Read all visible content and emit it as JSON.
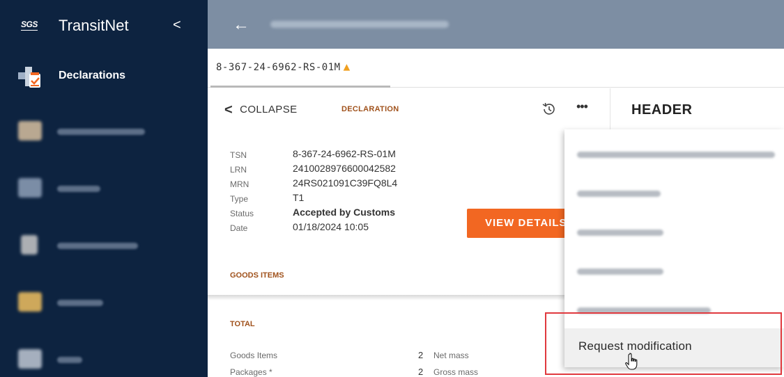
{
  "app": {
    "logo": "SGS",
    "name": "TransitNet",
    "collapse_glyph": "<"
  },
  "sidebar": {
    "active_item": {
      "label": "Declarations",
      "icon": "declarations-icon"
    },
    "blurred_items": [
      {
        "icon": "service-icon",
        "color": "#d8c0a0"
      },
      {
        "icon": "parties-icon",
        "color": "#8fa0b8"
      },
      {
        "icon": "reference-icon",
        "color": "#c8c8c8"
      },
      {
        "icon": "reports-icon",
        "color": "#f0c060"
      },
      {
        "icon": "user-icon",
        "color": "#c0c8d4"
      }
    ]
  },
  "topbar": {
    "back_icon": "arrow-left-icon"
  },
  "tab": {
    "label": "8-367-24-6962-RS-01M",
    "warning_icon": "warning-triangle-icon",
    "warning_color": "#f0a020"
  },
  "card": {
    "collapse_label": "COLLAPSE",
    "section_tab": "DECLARATION",
    "fields": [
      {
        "label": "TSN",
        "value": "8-367-24-6962-RS-01M"
      },
      {
        "label": "LRN",
        "value": "2410028976600042582"
      },
      {
        "label": "MRN",
        "value": "24RS021091C39FQ8L4"
      },
      {
        "label": "Type",
        "value": "T1"
      },
      {
        "label": "Status",
        "value": "Accepted by Customs"
      },
      {
        "label": "Date",
        "value": "01/18/2024 10:05"
      }
    ],
    "view_details": "VIEW DETAILS",
    "goods_items": "GOODS ITEMS",
    "accent_color": "#f26722"
  },
  "total": {
    "title": "TOTAL",
    "rows": [
      {
        "label": "Goods Items",
        "value": "2",
        "label2": "Net mass"
      },
      {
        "label": "Packages *",
        "value": "2",
        "label2": "Gross mass"
      }
    ]
  },
  "right_panel": {
    "title": "HEADER"
  },
  "menu": {
    "items": [
      {
        "blurred": true
      },
      {
        "blurred": true
      },
      {
        "blurred": true
      },
      {
        "blurred": true
      },
      {
        "blurred": true
      },
      {
        "blurred": false,
        "label": "Request modification"
      }
    ],
    "highlight_color": "#e0393e"
  }
}
